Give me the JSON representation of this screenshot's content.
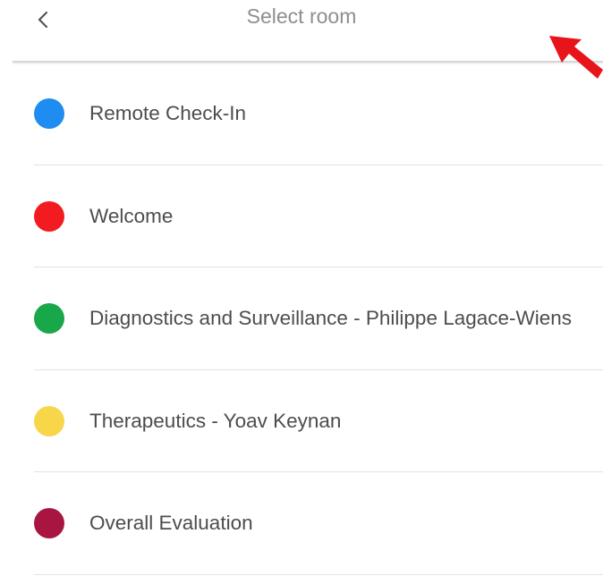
{
  "header": {
    "title": "Select room",
    "back_icon": "chevron-left-icon"
  },
  "annotation": {
    "arrow_color": "#e8141b"
  },
  "rooms": [
    {
      "label": "Remote Check-In",
      "color": "#1e8cf0"
    },
    {
      "label": "Welcome",
      "color": "#f21b20"
    },
    {
      "label": "Diagnostics and Surveillance - Philippe Lagace-Wiens",
      "color": "#18a84a"
    },
    {
      "label": "Therapeutics - Yoav Keynan",
      "color": "#f7d64a"
    },
    {
      "label": "Overall Evaluation",
      "color": "#a81540"
    }
  ]
}
